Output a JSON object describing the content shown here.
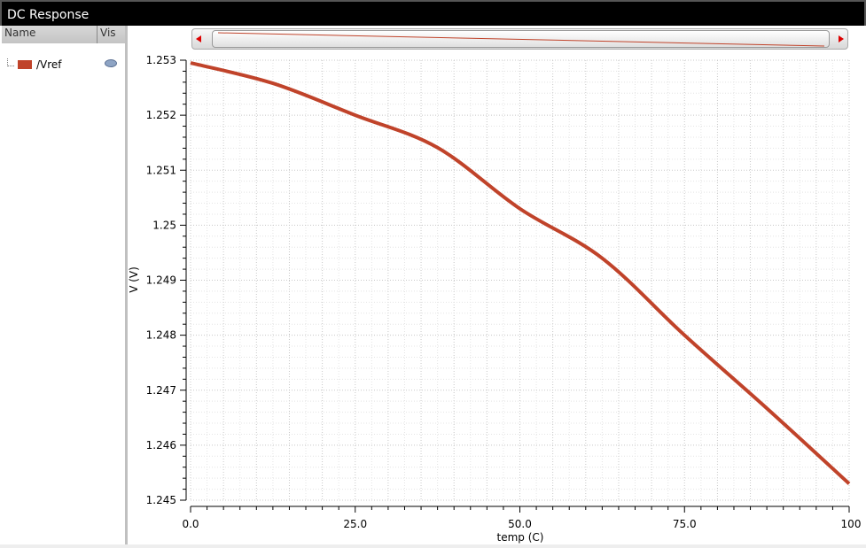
{
  "window": {
    "title": "DC Response"
  },
  "legend": {
    "col_name": "Name",
    "col_vis": "Vis",
    "items": [
      {
        "name": "/Vref",
        "color": "#c0432a",
        "visible_icon": "eye-icon"
      }
    ]
  },
  "chart_data": {
    "type": "line",
    "xlabel": "temp (C)",
    "ylabel": "V (V)",
    "xlim": [
      0,
      100
    ],
    "ylim": [
      1.245,
      1.253
    ],
    "xticks": [
      "0.0",
      "25.0",
      "50.0",
      "75.0",
      "100"
    ],
    "yticks": [
      "1.253",
      "1.252",
      "1.251",
      "1.25",
      "1.249",
      "1.248",
      "1.247",
      "1.246",
      "1.245"
    ],
    "grid": true,
    "series": [
      {
        "name": "/Vref",
        "color": "#c0432a",
        "x": [
          0,
          12.5,
          25,
          37.5,
          50,
          62.5,
          75,
          87.5,
          100
        ],
        "y": [
          1.25295,
          1.25258,
          1.252,
          1.25141,
          1.2503,
          1.2494,
          1.248,
          1.24667,
          1.2453
        ]
      }
    ]
  }
}
